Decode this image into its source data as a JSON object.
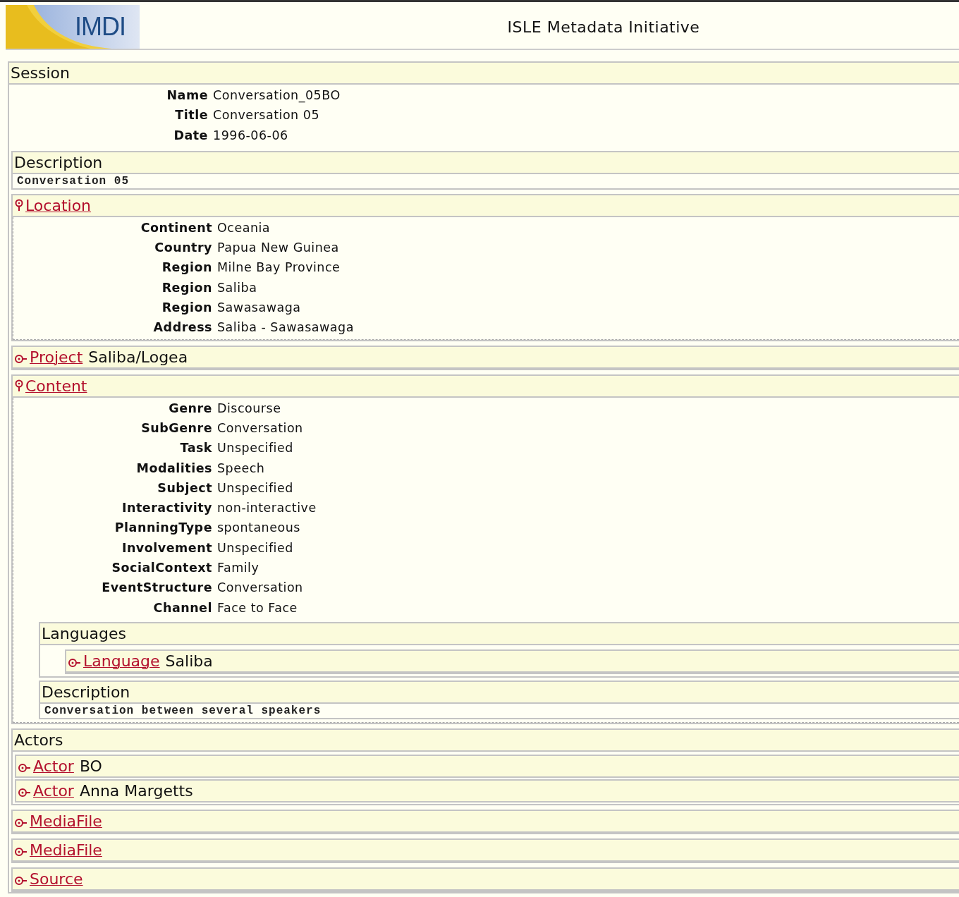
{
  "header": {
    "logo": "IMDI",
    "title": "ISLE Metadata Initiative"
  },
  "session": {
    "heading": "Session",
    "fields": [
      {
        "label": "Name",
        "value": "Conversation_05BO"
      },
      {
        "label": "Title",
        "value": "Conversation 05"
      },
      {
        "label": "Date",
        "value": "1996-06-06"
      }
    ],
    "blocks": [
      {
        "kind": "text",
        "heading": "Description",
        "text": "Conversation 05"
      },
      {
        "kind": "expanded",
        "link": "Location",
        "fields": [
          {
            "label": "Continent",
            "value": "Oceania"
          },
          {
            "label": "Country",
            "value": "Papua New Guinea"
          },
          {
            "label": "Region",
            "value": "Milne Bay Province"
          },
          {
            "label": "Region",
            "value": "Saliba"
          },
          {
            "label": "Region",
            "value": "Sawasawaga"
          },
          {
            "label": "Address",
            "value": "Saliba - Sawasawaga"
          }
        ]
      },
      {
        "kind": "collapsed",
        "link": "Project",
        "value": "Saliba/Logea"
      },
      {
        "kind": "expanded",
        "link": "Content",
        "fields": [
          {
            "label": "Genre",
            "value": "Discourse"
          },
          {
            "label": "SubGenre",
            "value": "Conversation"
          },
          {
            "label": "Task",
            "value": "Unspecified"
          },
          {
            "label": "Modalities",
            "value": "Speech"
          },
          {
            "label": "Subject",
            "value": "Unspecified"
          },
          {
            "label": "Interactivity",
            "value": "non-interactive"
          },
          {
            "label": "PlanningType",
            "value": "spontaneous"
          },
          {
            "label": "Involvement",
            "value": "Unspecified"
          },
          {
            "label": "SocialContext",
            "value": "Family"
          },
          {
            "label": "EventStructure",
            "value": "Conversation"
          },
          {
            "label": "Channel",
            "value": "Face to Face"
          }
        ],
        "blocks": [
          {
            "kind": "group",
            "heading": "Languages",
            "blocks": [
              {
                "kind": "collapsed",
                "link": "Language",
                "value": "Saliba"
              }
            ]
          },
          {
            "kind": "text",
            "heading": "Description",
            "text": "Conversation between several speakers"
          }
        ]
      },
      {
        "kind": "group",
        "heading": "Actors",
        "blocks": [
          {
            "kind": "collapsed",
            "link": "Actor",
            "value": "BO"
          },
          {
            "kind": "collapsed",
            "link": "Actor",
            "value": "Anna Margetts"
          }
        ]
      },
      {
        "kind": "collapsed",
        "link": "MediaFile"
      },
      {
        "kind": "collapsed",
        "link": "MediaFile"
      },
      {
        "kind": "collapsed",
        "link": "Source"
      }
    ]
  }
}
